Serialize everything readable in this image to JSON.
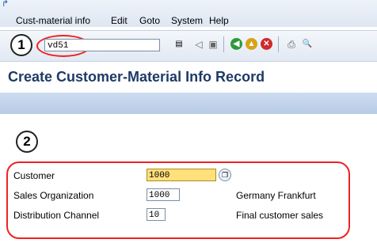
{
  "menu": {
    "items": [
      {
        "label": "Cust-material info"
      },
      {
        "label": "Edit"
      },
      {
        "label": "Goto"
      },
      {
        "label": "System"
      },
      {
        "label": "Help"
      }
    ]
  },
  "toolbar": {
    "command_value": "vd51",
    "icons": [
      "dropdown-icon",
      "back-arrow-icon",
      "save-icon",
      "green-check-icon",
      "exit-icon",
      "cancel-icon",
      "print-icon",
      "find-icon"
    ]
  },
  "callouts": [
    "1",
    "2"
  ],
  "page": {
    "title": "Create Customer-Material Info Record"
  },
  "form": {
    "fields": [
      {
        "label": "Customer",
        "value": "1000",
        "description": ""
      },
      {
        "label": "Sales Organization",
        "value": "1000",
        "description": "Germany Frankfurt"
      },
      {
        "label": "Distribution Channel",
        "value": "10",
        "description": "Final customer sales"
      }
    ]
  },
  "colors": {
    "title": "#1f3a66",
    "required_field": "#ffe07a",
    "callout_ring": "#e22222"
  }
}
